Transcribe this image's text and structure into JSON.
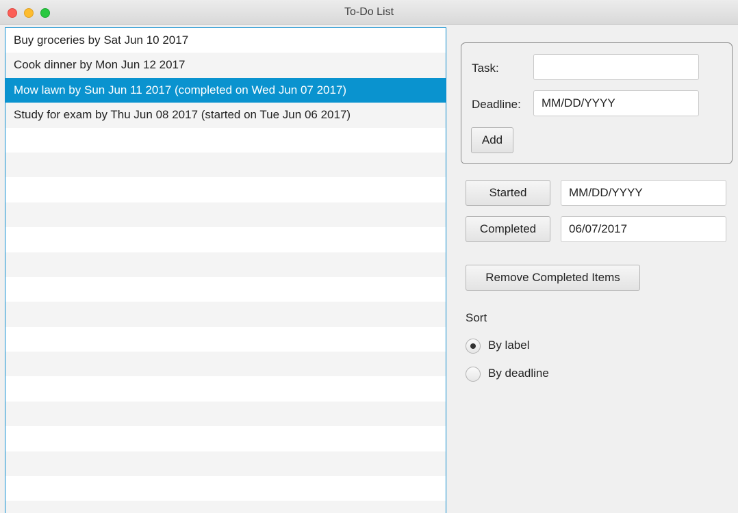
{
  "window": {
    "title": "To-Do List"
  },
  "list": {
    "items": [
      {
        "text": "Buy groceries by Sat Jun 10 2017",
        "selected": false
      },
      {
        "text": "Cook dinner by Mon Jun 12 2017",
        "selected": false
      },
      {
        "text": "Mow lawn by Sun Jun 11 2017 (completed on Wed Jun 07 2017)",
        "selected": true
      },
      {
        "text": "Study for exam by Thu Jun 08 2017 (started on Tue Jun 06 2017)",
        "selected": false
      }
    ]
  },
  "add_form": {
    "task_label": "Task:",
    "task_value": "",
    "deadline_label": "Deadline:",
    "deadline_value": "MM/DD/YYYY",
    "add_label": "Add"
  },
  "status": {
    "started_label": "Started",
    "started_value": "MM/DD/YYYY",
    "completed_label": "Completed",
    "completed_value": "06/07/2017",
    "remove_label": "Remove Completed Items"
  },
  "sort": {
    "heading": "Sort",
    "options": [
      {
        "label": "By label",
        "checked": true
      },
      {
        "label": "By deadline",
        "checked": false
      }
    ]
  },
  "colors": {
    "selection": "#0a93cf",
    "list_border": "#0a8ccf"
  }
}
